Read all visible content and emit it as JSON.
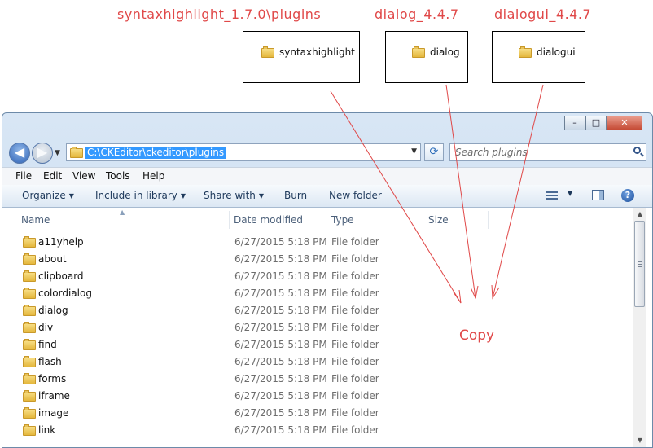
{
  "annotations": {
    "labels": [
      "syntaxhighlight_1.7.0\\plugins",
      "dialog_4.4.7",
      "dialogui_4.4.7"
    ],
    "sources": [
      "syntaxhighlight",
      "dialog",
      "dialogui"
    ],
    "copy": "Copy",
    "color": "#e04848"
  },
  "window": {
    "controls": {
      "minimize": "–",
      "maximize": "□",
      "close": "✕"
    }
  },
  "navigation": {
    "back_glyph": "◀",
    "forward_glyph": "▶",
    "address": "C:\\CKEditor\\ckeditor\\plugins",
    "search_placeholder": "Search plugins",
    "refresh_glyph": "⟳"
  },
  "menu": [
    "File",
    "Edit",
    "View",
    "Tools",
    "Help"
  ],
  "toolbar": {
    "organize": "Organize",
    "include_in_library": "Include in library",
    "share_with": "Share with",
    "burn": "Burn",
    "new_folder": "New folder",
    "help_glyph": "?"
  },
  "columns": {
    "name": "Name",
    "date": "Date modified",
    "type": "Type",
    "size": "Size"
  },
  "files": [
    {
      "name": "a11yhelp",
      "date": "6/27/2015 5:18 PM",
      "type": "File folder"
    },
    {
      "name": "about",
      "date": "6/27/2015 5:18 PM",
      "type": "File folder"
    },
    {
      "name": "clipboard",
      "date": "6/27/2015 5:18 PM",
      "type": "File folder"
    },
    {
      "name": "colordialog",
      "date": "6/27/2015 5:18 PM",
      "type": "File folder"
    },
    {
      "name": "dialog",
      "date": "6/27/2015 5:18 PM",
      "type": "File folder"
    },
    {
      "name": "div",
      "date": "6/27/2015 5:18 PM",
      "type": "File folder"
    },
    {
      "name": "find",
      "date": "6/27/2015 5:18 PM",
      "type": "File folder"
    },
    {
      "name": "flash",
      "date": "6/27/2015 5:18 PM",
      "type": "File folder"
    },
    {
      "name": "forms",
      "date": "6/27/2015 5:18 PM",
      "type": "File folder"
    },
    {
      "name": "iframe",
      "date": "6/27/2015 5:18 PM",
      "type": "File folder"
    },
    {
      "name": "image",
      "date": "6/27/2015 5:18 PM",
      "type": "File folder"
    },
    {
      "name": "link",
      "date": "6/27/2015 5:18 PM",
      "type": "File folder"
    }
  ]
}
